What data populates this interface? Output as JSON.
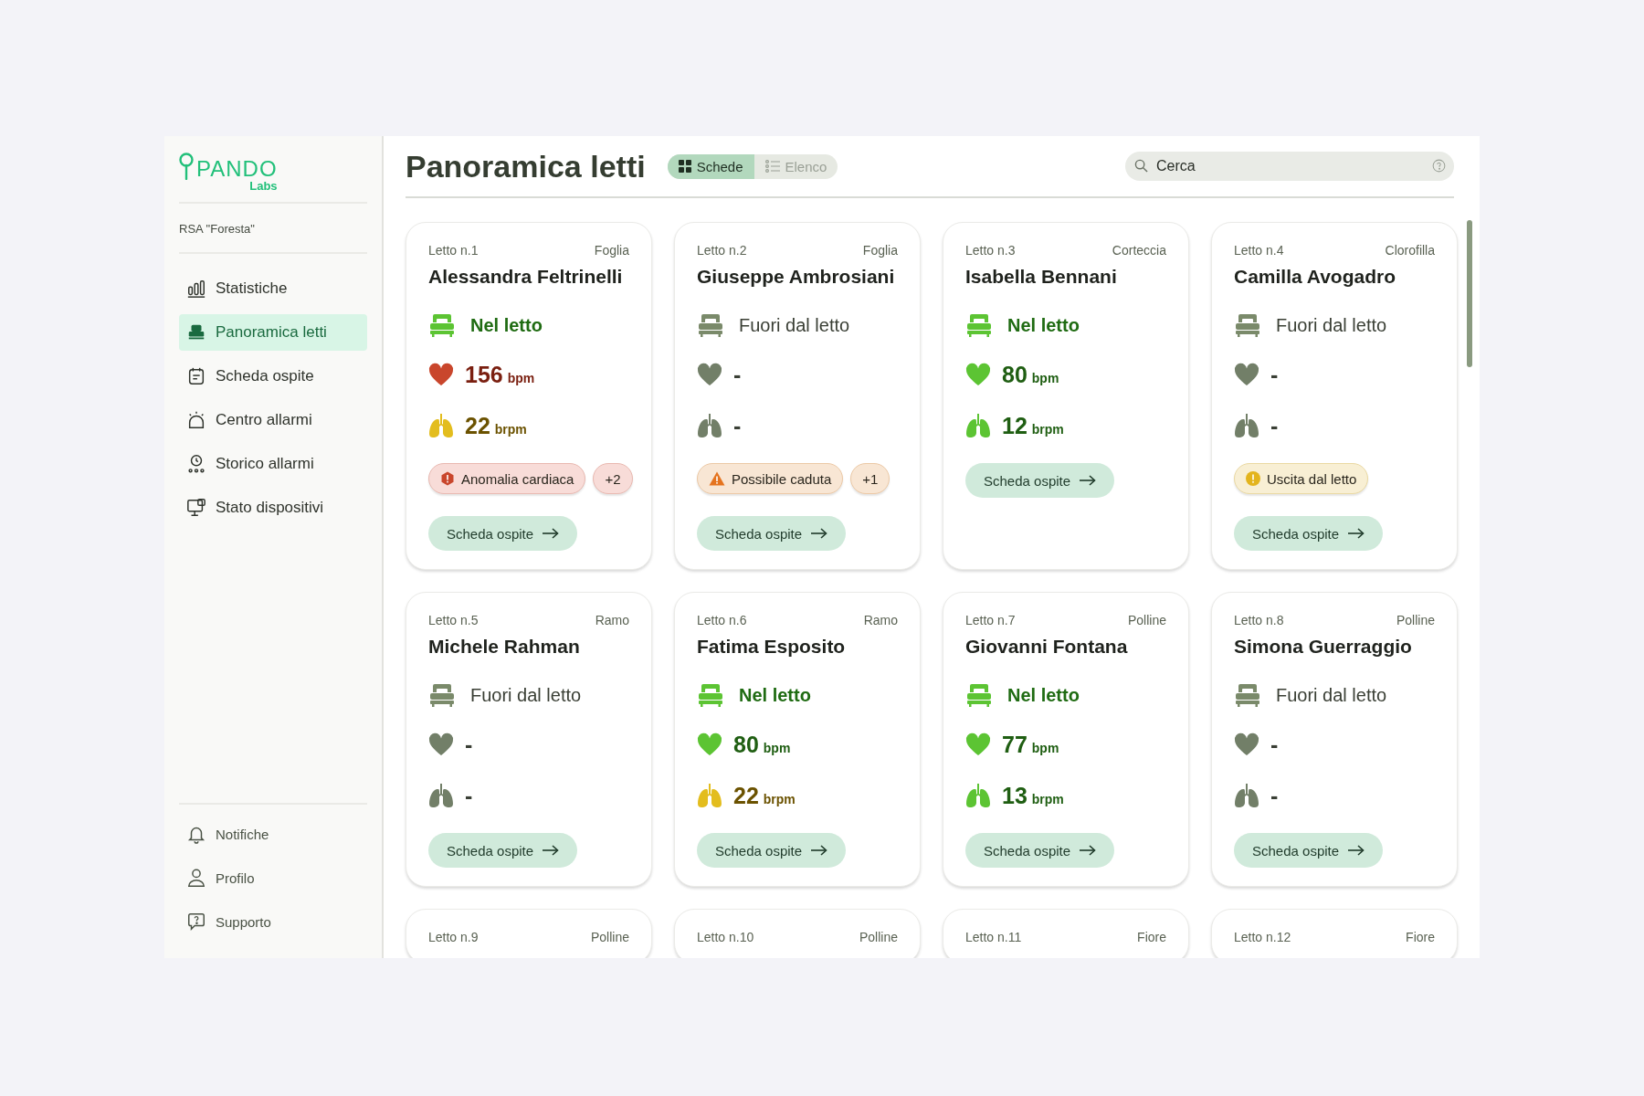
{
  "logo": {
    "name": "PANDO",
    "sub": "Labs"
  },
  "facility": "RSA \"Foresta\"",
  "nav": [
    {
      "label": "Statistiche",
      "selected": false
    },
    {
      "label": "Panoramica letti",
      "selected": true
    },
    {
      "label": "Scheda ospite",
      "selected": false
    },
    {
      "label": "Centro allarmi",
      "selected": false
    },
    {
      "label": "Storico allarmi",
      "selected": false
    },
    {
      "label": "Stato dispositivi",
      "selected": false
    }
  ],
  "footer_nav": [
    {
      "label": "Notifiche"
    },
    {
      "label": "Profilo"
    },
    {
      "label": "Supporto"
    }
  ],
  "header": {
    "title": "Panoramica letti",
    "views": [
      {
        "label": "Schede",
        "selected": true
      },
      {
        "label": "Elenco",
        "selected": false
      }
    ],
    "search": {
      "placeholder": "Cerca"
    }
  },
  "cards": [
    {
      "bed": "Letto n.1",
      "ward": "Foglia",
      "name": "Alessandra Feltrinelli",
      "presence": {
        "kind": "in_bed",
        "label": "Nel letto"
      },
      "heart": {
        "kind": "high",
        "value": "156",
        "unit": "bpm"
      },
      "breath": {
        "kind": "elevated",
        "value": "22",
        "unit": "brpm"
      },
      "alerts": [
        {
          "kind": "critical",
          "label": "Anomalia cardiaca"
        }
      ],
      "more": "+2",
      "button": "Scheda ospite"
    },
    {
      "bed": "Letto n.2",
      "ward": "Foglia",
      "name": "Giuseppe Ambrosiani",
      "presence": {
        "kind": "out_of_bed",
        "label": "Fuori dal letto"
      },
      "heart": {
        "kind": "none",
        "value": "-"
      },
      "breath": {
        "kind": "none",
        "value": "-"
      },
      "alerts": [
        {
          "kind": "warning",
          "label": "Possibile caduta"
        }
      ],
      "more": "+1",
      "button": "Scheda ospite"
    },
    {
      "bed": "Letto n.3",
      "ward": "Corteccia",
      "name": "Isabella Bennani",
      "presence": {
        "kind": "in_bed",
        "label": "Nel letto"
      },
      "heart": {
        "kind": "normal",
        "value": "80",
        "unit": "bpm"
      },
      "breath": {
        "kind": "normal",
        "value": "12",
        "unit": "brpm"
      },
      "button": "Scheda ospite"
    },
    {
      "bed": "Letto n.4",
      "ward": "Clorofilla",
      "name": "Camilla Avogadro",
      "presence": {
        "kind": "out_of_bed",
        "label": "Fuori dal letto"
      },
      "heart": {
        "kind": "none",
        "value": "-"
      },
      "breath": {
        "kind": "none",
        "value": "-"
      },
      "alerts": [
        {
          "kind": "caution",
          "label": "Uscita dal letto"
        }
      ],
      "button": "Scheda ospite"
    },
    {
      "bed": "Letto n.5",
      "ward": "Ramo",
      "name": "Michele Rahman",
      "presence": {
        "kind": "out_of_bed",
        "label": "Fuori dal letto"
      },
      "heart": {
        "kind": "none",
        "value": "-"
      },
      "breath": {
        "kind": "none",
        "value": "-"
      },
      "button": "Scheda ospite"
    },
    {
      "bed": "Letto n.6",
      "ward": "Ramo",
      "name": "Fatima Esposito",
      "presence": {
        "kind": "in_bed",
        "label": "Nel letto"
      },
      "heart": {
        "kind": "normal",
        "value": "80",
        "unit": "bpm"
      },
      "breath": {
        "kind": "elevated",
        "value": "22",
        "unit": "brpm"
      },
      "button": "Scheda ospite"
    },
    {
      "bed": "Letto n.7",
      "ward": "Polline",
      "name": "Giovanni Fontana",
      "presence": {
        "kind": "in_bed",
        "label": "Nel letto"
      },
      "heart": {
        "kind": "normal",
        "value": "77",
        "unit": "bpm"
      },
      "breath": {
        "kind": "normal",
        "value": "13",
        "unit": "brpm"
      },
      "button": "Scheda ospite"
    },
    {
      "bed": "Letto n.8",
      "ward": "Polline",
      "name": "Simona Guerraggio",
      "presence": {
        "kind": "out_of_bed",
        "label": "Fuori dal letto"
      },
      "heart": {
        "kind": "none",
        "value": "-"
      },
      "breath": {
        "kind": "none",
        "value": "-"
      },
      "button": "Scheda ospite"
    },
    {
      "bed": "Letto n.9",
      "ward": "Polline"
    },
    {
      "bed": "Letto n.10",
      "ward": "Polline"
    },
    {
      "bed": "Letto n.11",
      "ward": "Fiore"
    },
    {
      "bed": "Letto n.12",
      "ward": "Fiore"
    }
  ]
}
